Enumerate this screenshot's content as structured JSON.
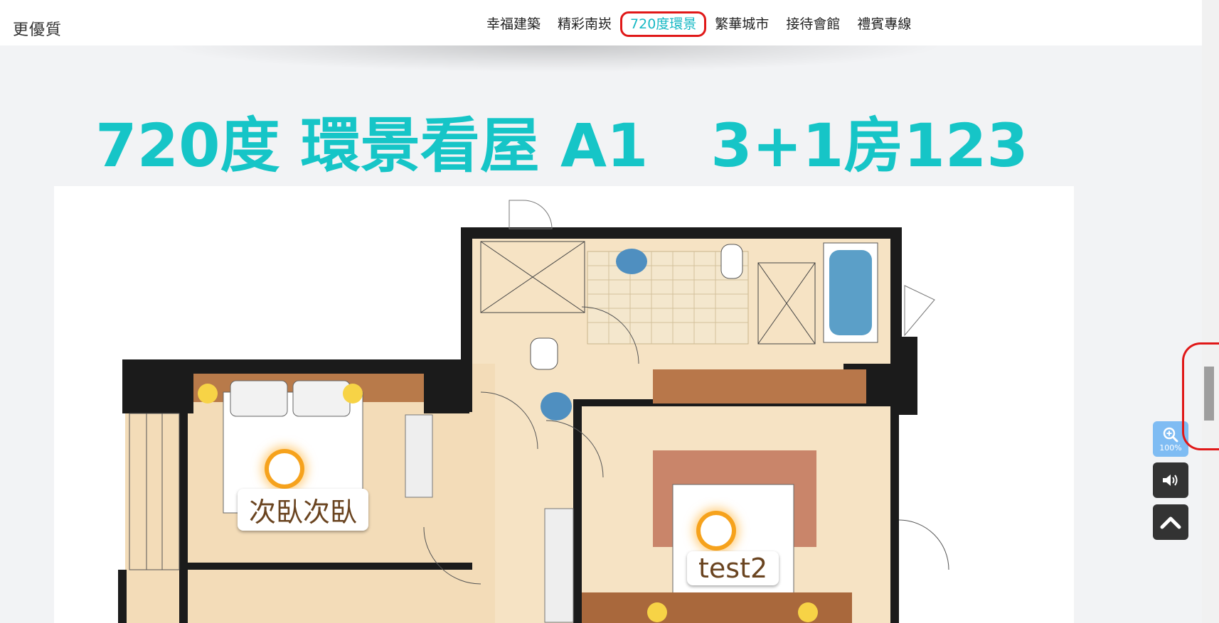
{
  "header": {
    "brand": "更優質",
    "nav": [
      {
        "label": "幸福建築",
        "active": false
      },
      {
        "label": "精彩南崁",
        "active": false
      },
      {
        "label": "720度環景",
        "active": true
      },
      {
        "label": "繁華城市",
        "active": false
      },
      {
        "label": "接待會館",
        "active": false
      },
      {
        "label": "禮賓專線",
        "active": false
      }
    ]
  },
  "main": {
    "title": "720度 環景看屋 A1   3+1房123",
    "hotspots": [
      {
        "label": "次臥次臥"
      },
      {
        "label": "test2"
      }
    ]
  },
  "controls": {
    "zoom_label": "100%",
    "zoom_icon": "magnifier-plus-icon",
    "sound_icon": "speaker-icon",
    "top_icon": "chevron-up-icon"
  },
  "colors": {
    "accent": "#16c5c7",
    "highlight": "#e01818",
    "hotspot": "#f6a21c"
  }
}
